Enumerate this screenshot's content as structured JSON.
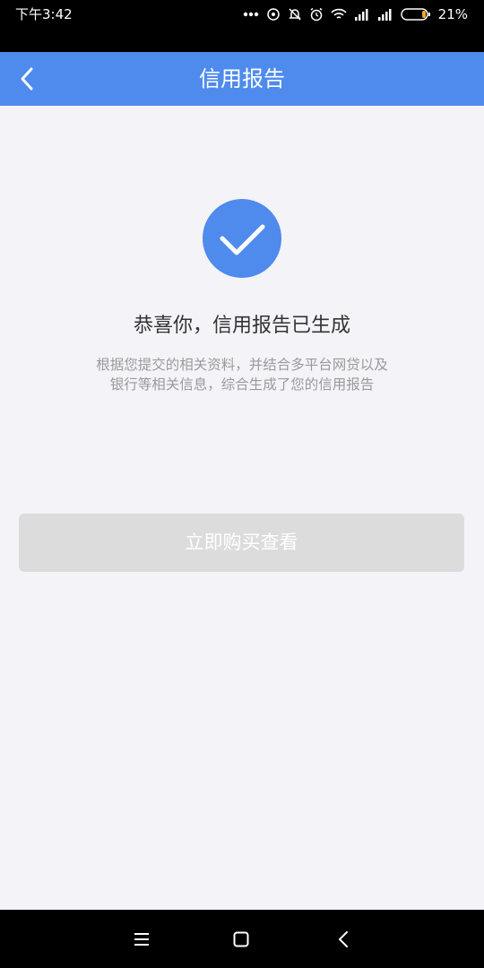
{
  "status_bar": {
    "time": "下午3:42",
    "battery": "21%"
  },
  "header": {
    "title": "信用报告"
  },
  "main": {
    "title": "恭喜你，信用报告已生成",
    "description_line1": "根据您提交的相关资料，并结合多平台网贷以及",
    "description_line2": "银行等相关信息，综合生成了您的信用报告",
    "button_label": "立即购买查看"
  },
  "colors": {
    "primary": "#4e8bec",
    "background": "#f4f3f7",
    "button_disabled": "#dcdcdc",
    "battery_low": "#f5a623"
  },
  "icons": {
    "back": "chevron-left-icon",
    "success": "check-circle-icon",
    "menu": "menu-icon",
    "home": "home-icon",
    "system_back": "system-back-icon"
  }
}
